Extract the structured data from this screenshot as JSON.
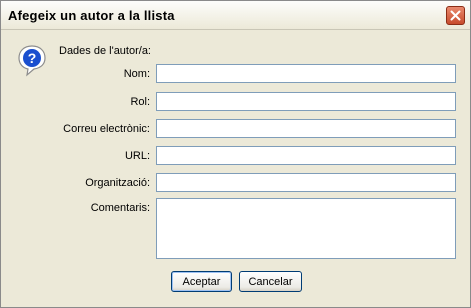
{
  "window": {
    "title": "Afegeix un autor a la llista"
  },
  "icons": {
    "dialog_icon": "question-icon",
    "close": "close-icon"
  },
  "form": {
    "section_title": "Dades de l'autor/a:",
    "fields": [
      {
        "label": "Nom:",
        "value": ""
      },
      {
        "label": "Rol:",
        "value": ""
      },
      {
        "label": "Correu electrònic:",
        "value": ""
      },
      {
        "label": "URL:",
        "value": ""
      },
      {
        "label": "Organització:",
        "value": ""
      },
      {
        "label": "Comentaris:",
        "value": ""
      }
    ]
  },
  "buttons": {
    "ok_label": "Aceptar",
    "cancel_label": "Cancelar"
  },
  "colors": {
    "dialog_bg": "#ece9d8",
    "close_button": "#d3562f",
    "field_border": "#7f9db9",
    "button_border": "#003c74"
  }
}
